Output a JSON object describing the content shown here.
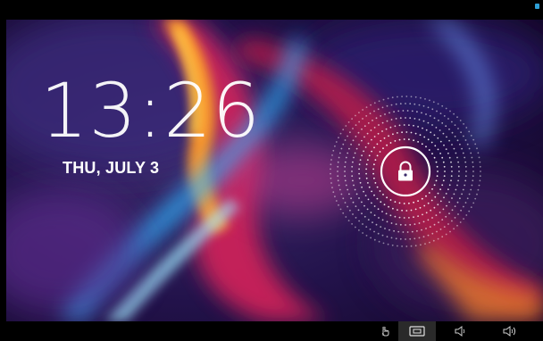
{
  "lockscreen": {
    "time": "13:26",
    "date": "THU, JULY 3",
    "lock_icon": "lock-icon"
  },
  "status_bar": {
    "icon": "signal-indicator-icon",
    "accent_color": "#2e9fd6"
  },
  "navigation_bar": {
    "buttons": [
      {
        "icon": "hand-tap-icon"
      },
      {
        "icon": "screenshot-icon"
      },
      {
        "icon": "volume-down-icon"
      },
      {
        "icon": "volume-up-icon"
      }
    ]
  },
  "colors": {
    "background": "#000000",
    "text": "#ffffff"
  }
}
